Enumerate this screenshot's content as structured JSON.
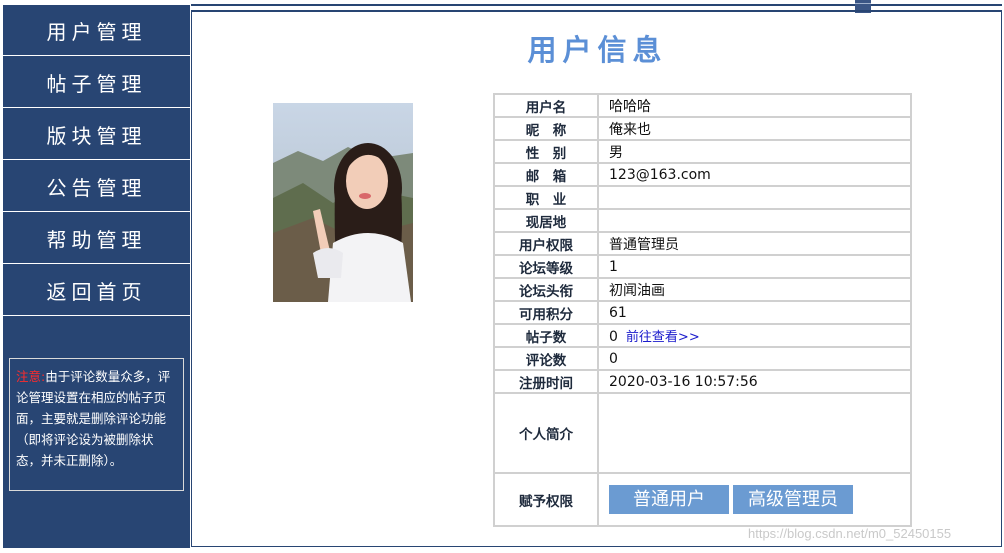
{
  "sidebar": {
    "items": [
      {
        "label": "用户管理"
      },
      {
        "label": "帖子管理"
      },
      {
        "label": "版块管理"
      },
      {
        "label": "公告管理"
      },
      {
        "label": "帮助管理"
      },
      {
        "label": "返回首页"
      }
    ],
    "notice_label": "注意:",
    "notice_text": "由于评论数量众多，评论管理设置在相应的帖子页面，主要就是删除评论功能（即将评论设为被删除状态，并未正删除）。"
  },
  "main": {
    "title": "用户信息"
  },
  "profile": {
    "rows": [
      {
        "key": "用户名",
        "value": "哈哈哈"
      },
      {
        "key": "昵　称",
        "value": "俺来也"
      },
      {
        "key": "性　别",
        "value": "男"
      },
      {
        "key": "邮　箱",
        "value": "123@163.com"
      },
      {
        "key": "职　业",
        "value": ""
      },
      {
        "key": "现居地",
        "value": ""
      },
      {
        "key": "用户权限",
        "value": "普通管理员"
      },
      {
        "key": "论坛等级",
        "value": "1"
      },
      {
        "key": "论坛头衔",
        "value": "初闻油画"
      },
      {
        "key": "可用积分",
        "value": "61"
      },
      {
        "key": "帖子数",
        "value": "0",
        "link": "前往查看>>"
      },
      {
        "key": "评论数",
        "value": "0"
      },
      {
        "key": "注册时间",
        "value": "2020-03-16 10:57:56"
      }
    ],
    "bio_key": "个人简介",
    "bio_value": "",
    "perm_key": "赋予权限",
    "perm_buttons": [
      "普通用户",
      "高级管理员"
    ]
  },
  "watermark": "https://blog.csdn.net/m0_52450155",
  "colors": {
    "sidebar_bg": "#284573",
    "title": "#5b8fd6",
    "button": "#6b9bd2",
    "notice_label": "#ff2b2b",
    "link": "#1a1acc"
  }
}
